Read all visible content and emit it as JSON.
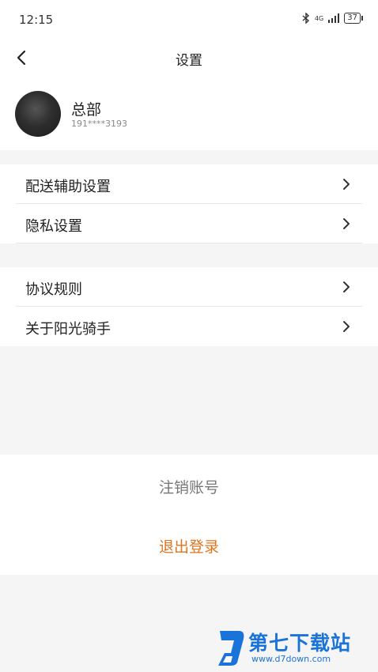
{
  "status": {
    "time": "12:15",
    "network": "4G",
    "battery": "37"
  },
  "header": {
    "title": "设置"
  },
  "profile": {
    "name": "总部",
    "phone": "191****3193"
  },
  "groups": [
    {
      "items": [
        {
          "label": "配送辅助设置"
        },
        {
          "label": "隐私设置"
        }
      ]
    },
    {
      "items": [
        {
          "label": "协议规则"
        },
        {
          "label": "关于阳光骑手"
        }
      ]
    }
  ],
  "actions": {
    "cancel_account": "注销账号",
    "logout": "退出登录"
  },
  "watermark": {
    "title": "第七下载站",
    "url": "www.d7down.com"
  },
  "colors": {
    "accent": "#e0741f",
    "background": "#f5f5f5",
    "watermark": "#1a73d9"
  }
}
